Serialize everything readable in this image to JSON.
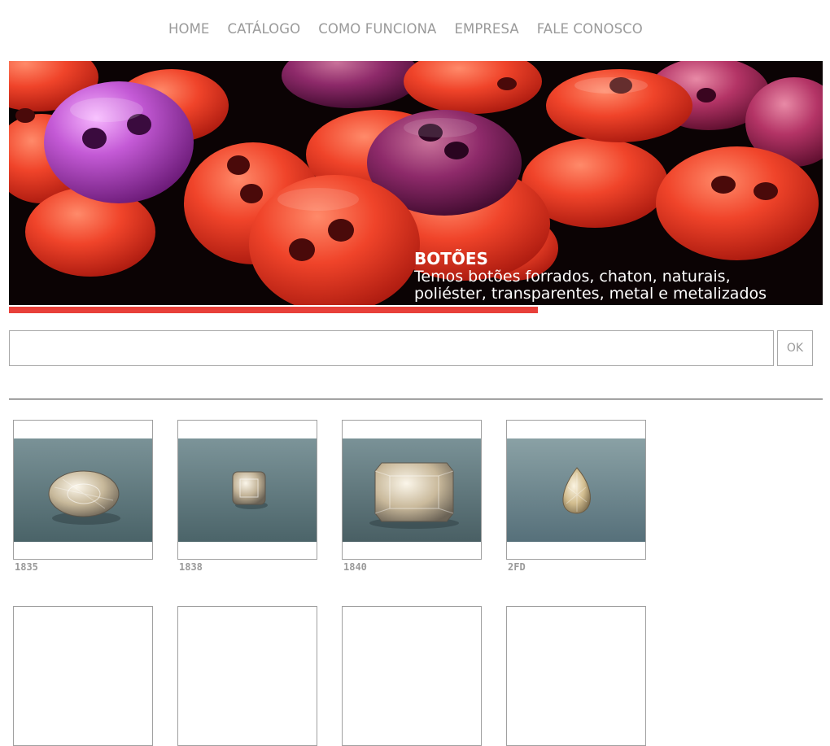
{
  "nav": {
    "items": [
      {
        "label": "HOME"
      },
      {
        "label": "CATÁLOGO"
      },
      {
        "label": "COMO FUNCIONA"
      },
      {
        "label": "EMPRESA"
      },
      {
        "label": "FALE CONOSCO"
      }
    ]
  },
  "banner": {
    "title": "BOTÕES",
    "lines": [
      "Temos botões forrados, chaton, naturais,",
      "poliéster, transparentes, metal e metalizados"
    ],
    "slide_progress": 0.65,
    "colors": {
      "accent": "#e8403a",
      "background": "#0b0304"
    }
  },
  "search": {
    "value": "",
    "placeholder": "",
    "button_label": "OK"
  },
  "products": [
    {
      "code": "1835",
      "icon": "oval-crystal-button-photo"
    },
    {
      "code": "1838",
      "icon": "square-crystal-button-photo"
    },
    {
      "code": "1840",
      "icon": "rectangular-crystal-button-photo"
    },
    {
      "code": "2FD",
      "icon": "teardrop-crystal-button-photo"
    }
  ]
}
